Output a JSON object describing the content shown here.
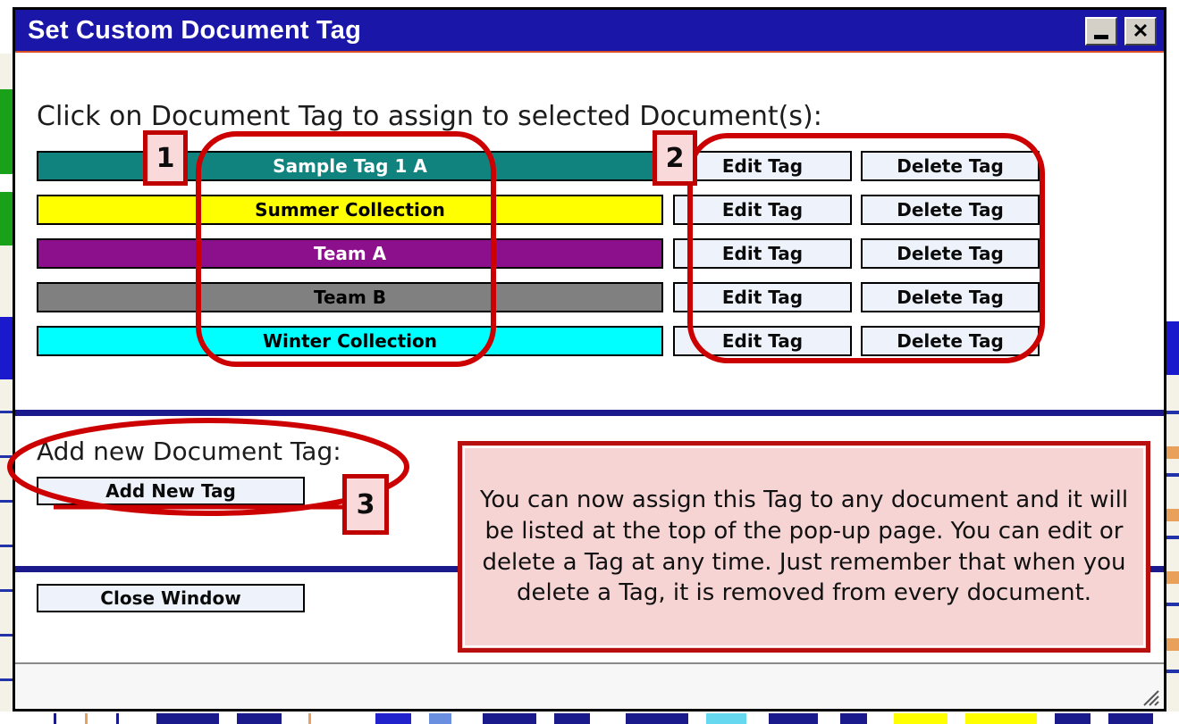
{
  "window": {
    "title": "Set Custom Document Tag",
    "minimize_label": "_",
    "close_label": "✕"
  },
  "main": {
    "heading": "Click on Document Tag to assign to selected Document(s):",
    "add_section_label": "Add new Document Tag:",
    "add_new_tag_label": "Add New Tag",
    "close_window_label": "Close Window"
  },
  "tags": [
    {
      "name": "Sample Tag 1 A",
      "bg": "#11837f",
      "fg": "#ffffff",
      "edit_label": "Edit Tag",
      "delete_label": "Delete Tag"
    },
    {
      "name": "Summer Collection",
      "bg": "#ffff00",
      "fg": "#000000",
      "edit_label": "Edit Tag",
      "delete_label": "Delete Tag"
    },
    {
      "name": "Team A",
      "bg": "#8c0f8c",
      "fg": "#ffffff",
      "edit_label": "Edit Tag",
      "delete_label": "Delete Tag"
    },
    {
      "name": "Team B",
      "bg": "#808080",
      "fg": "#000000",
      "edit_label": "Edit Tag",
      "delete_label": "Delete Tag"
    },
    {
      "name": "Winter Collection",
      "bg": "#00ffff",
      "fg": "#000000",
      "edit_label": "Edit Tag",
      "delete_label": "Delete Tag"
    }
  ],
  "annotations": {
    "badge_1": "1",
    "badge_2": "2",
    "badge_3": "3",
    "callout_text": "You can now assign this Tag to any document and it will be listed at the top of the pop-up page. You can edit or delete a Tag at any time.  Just remember that when you delete a Tag, it is removed from every document.",
    "accent_red": "#c00000",
    "callout_fill": "#f6d4d4"
  },
  "colors": {
    "titlebar": "#1a17a8",
    "separator": "#1a1a8c",
    "button_fill": "#eef3fb"
  }
}
